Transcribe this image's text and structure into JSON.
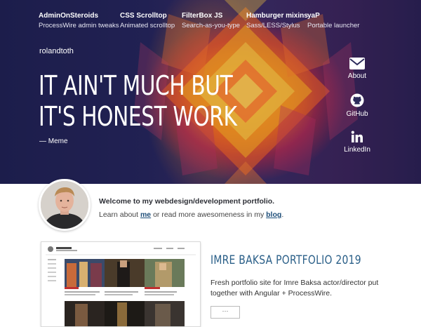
{
  "nav": [
    {
      "title": "AdminOnSteroids",
      "sub": "ProcessWire admin tweaks"
    },
    {
      "title": "CSS Scrolltop",
      "sub": "Animated scrolltop"
    },
    {
      "title": "FilterBox JS",
      "sub": "Search-as-you-type"
    },
    {
      "title": "Hamburger mixins",
      "sub": "Sass/LESS/Stylus"
    },
    {
      "title": "yaP",
      "sub": "Portable launcher"
    }
  ],
  "hero": {
    "username": "rolandtoth",
    "quote": "IT AIN'T MUCH BUT IT'S HONEST WORK",
    "quote_author": "— Meme"
  },
  "social": [
    {
      "label": "About",
      "icon": "envelope-icon"
    },
    {
      "label": "GitHub",
      "icon": "github-icon"
    },
    {
      "label": "LinkedIn",
      "icon": "linkedin-icon"
    }
  ],
  "intro": {
    "welcome": "Welcome to my webdesign/development portfolio.",
    "learn_prefix": "Learn about ",
    "learn_me": "me",
    "learn_middle": " or read more awesomeness in my ",
    "learn_blog": "blog",
    "learn_suffix": "."
  },
  "project": {
    "title": "IMRE BAKSA PORTFOLIO 2019",
    "description": "Fresh portfolio site for Imre Baksa actor/director put together with Angular + ProcessWire.",
    "more_label": "···"
  },
  "colors": {
    "accent_blue": "#2a5f88",
    "hero_dark": "#23234f",
    "hero_orange": "#ff8a1e"
  }
}
